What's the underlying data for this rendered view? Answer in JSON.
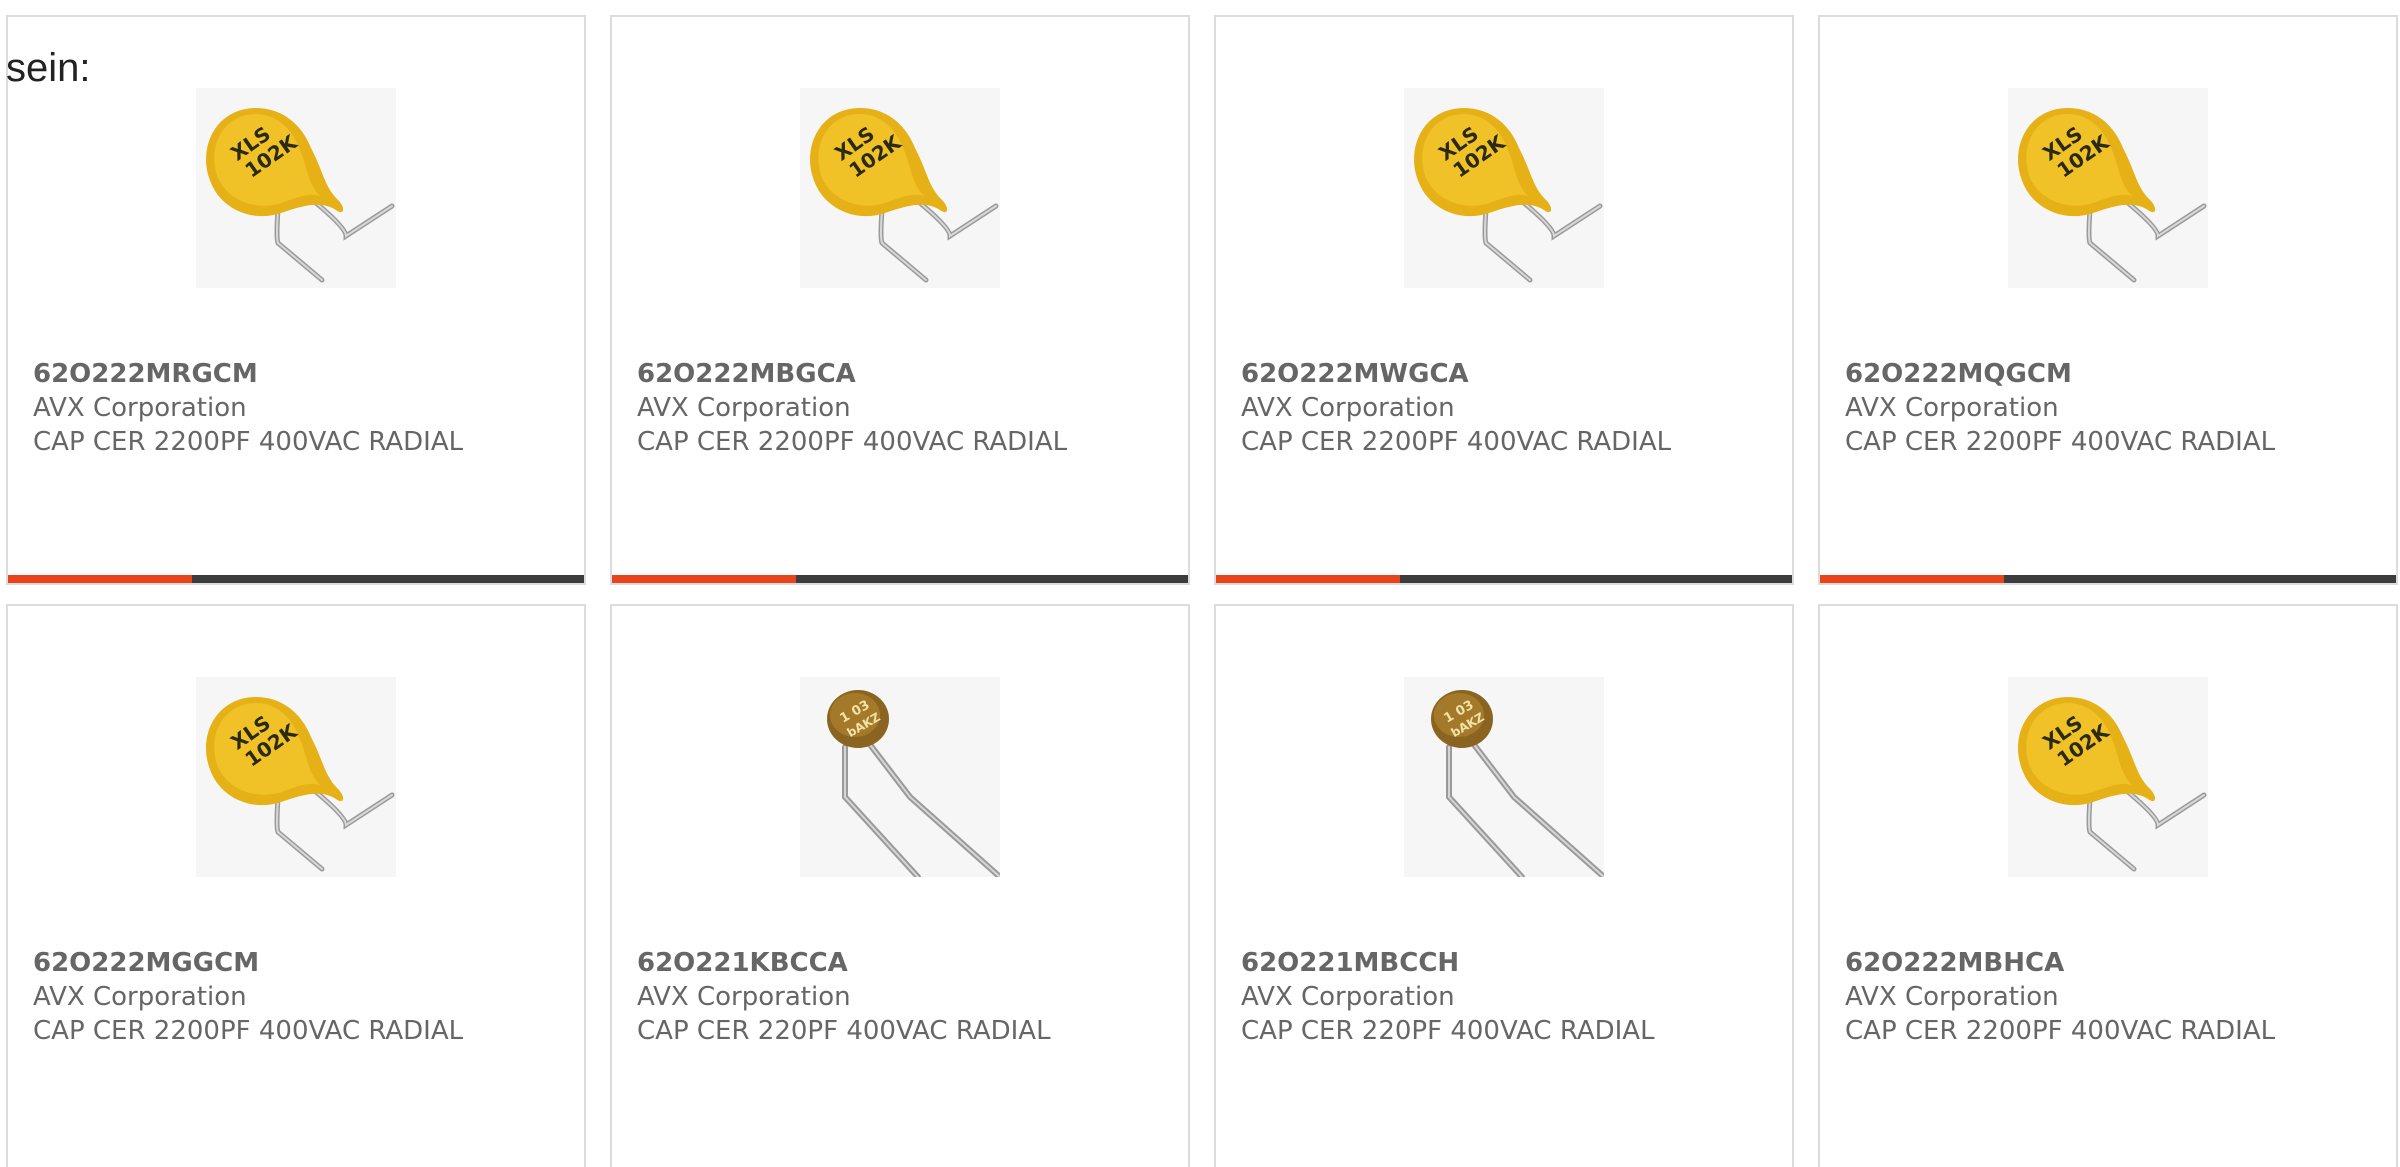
{
  "intro_text": "sein:",
  "colors": {
    "accent": "#e8431a",
    "bar_track": "#3c3c3c",
    "text": "#666666",
    "card_border": "#dcdcdc"
  },
  "products": [
    {
      "part": "62O222MRGCM",
      "manufacturer": "AVX Corporation",
      "description": "CAP CER 2200PF 400VAC RADIAL",
      "image": "yellow-disc-capacitor-icon",
      "progress_fraction": 0.32
    },
    {
      "part": "62O222MBGCA",
      "manufacturer": "AVX Corporation",
      "description": "CAP CER 2200PF 400VAC RADIAL",
      "image": "yellow-disc-capacitor-icon",
      "progress_fraction": 0.32
    },
    {
      "part": "62O222MWGCA",
      "manufacturer": "AVX Corporation",
      "description": "CAP CER 2200PF 400VAC RADIAL",
      "image": "yellow-disc-capacitor-icon",
      "progress_fraction": 0.32
    },
    {
      "part": "62O222MQGCM",
      "manufacturer": "AVX Corporation",
      "description": "CAP CER 2200PF 400VAC RADIAL",
      "image": "yellow-disc-capacitor-icon",
      "progress_fraction": 0.32
    },
    {
      "part": "62O222MGGCM",
      "manufacturer": "AVX Corporation",
      "description": "CAP CER 2200PF 400VAC RADIAL",
      "image": "yellow-disc-capacitor-icon"
    },
    {
      "part": "62O221KBCCA",
      "manufacturer": "AVX Corporation",
      "description": "CAP CER 220PF 400VAC RADIAL",
      "image": "brown-disc-capacitor-icon"
    },
    {
      "part": "62O221MBCCH",
      "manufacturer": "AVX Corporation",
      "description": "CAP CER 220PF 400VAC RADIAL",
      "image": "brown-disc-capacitor-icon"
    },
    {
      "part": "62O222MBHCA",
      "manufacturer": "AVX Corporation",
      "description": "CAP CER 2200PF 400VAC RADIAL",
      "image": "yellow-disc-capacitor-icon"
    }
  ]
}
